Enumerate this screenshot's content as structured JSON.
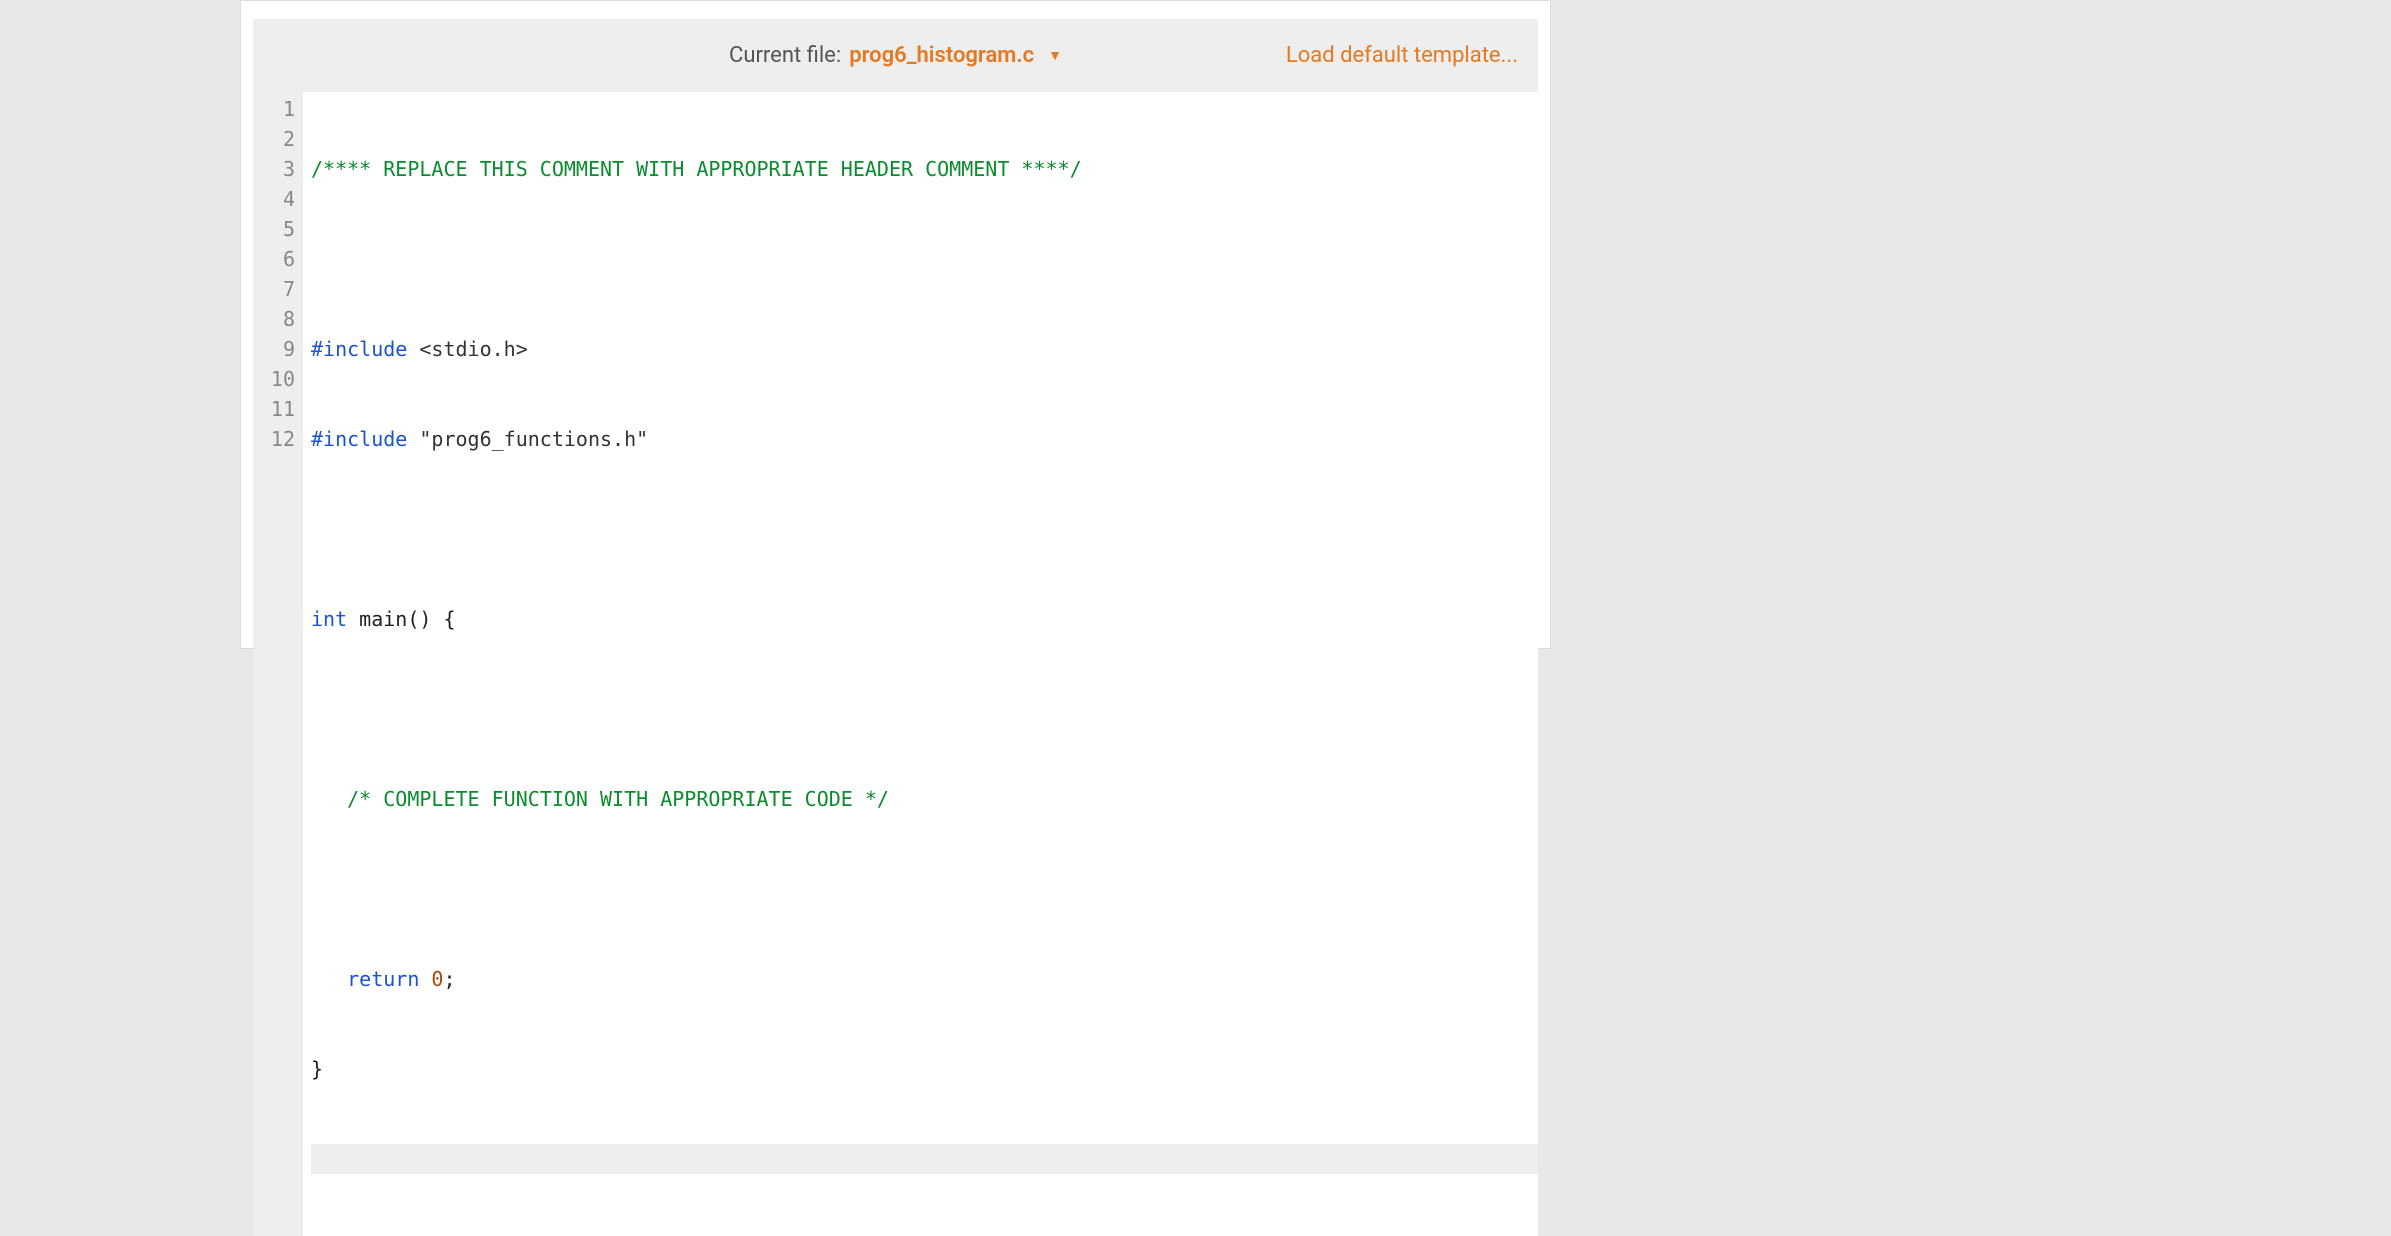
{
  "header": {
    "current_file_label": "Current file:",
    "current_file_name": "prog6_histogram.c",
    "load_template_label": "Load default template..."
  },
  "editor": {
    "line_count": 12,
    "active_line": 12,
    "lines": {
      "l1_comment": "/**** REPLACE THIS COMMENT WITH APPROPRIATE HEADER COMMENT ****/",
      "l3_pp": "#include",
      "l3_rest": " <stdio.h>",
      "l4_pp": "#include",
      "l4_rest": " \"prog6_functions.h\"",
      "l6_type": "int",
      "l6_rest": " main() {",
      "l8_comment": "   /* COMPLETE FUNCTION WITH APPROPRIATE CODE */",
      "l10_indent": "   ",
      "l10_kw": "return",
      "l10_sp": " ",
      "l10_num": "0",
      "l10_semi": ";",
      "l11_brace": "}"
    },
    "gutter": {
      "n1": "1",
      "n2": "2",
      "n3": "3",
      "n4": "4",
      "n5": "5",
      "n6": "6",
      "n7": "7",
      "n8": "8",
      "n9": "9",
      "n10": "10",
      "n11": "11",
      "n12": "12"
    }
  }
}
